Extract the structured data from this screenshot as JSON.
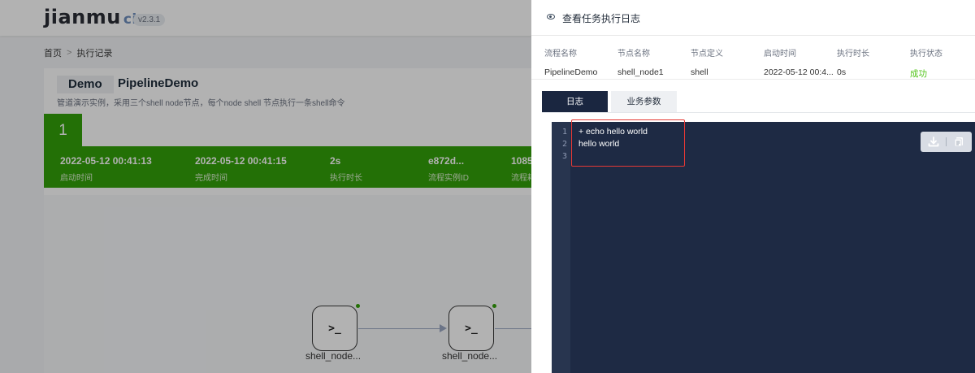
{
  "app": {
    "logo_main": "jianmu",
    "logo_suffix": "ci",
    "version": "v2.3.1"
  },
  "breadcrumb": {
    "home": "首页",
    "separator": ">",
    "current": "执行记录"
  },
  "project": {
    "tag": "Demo",
    "name": "PipelineDemo",
    "description": "管道演示实例，采用三个shell node节点，每个node shell 节点执行一条shell命令"
  },
  "run": {
    "number": "1",
    "status_color": "#33a10a",
    "stats": [
      {
        "value": "2022-05-12 00:41:13",
        "label": "启动时间"
      },
      {
        "value": "2022-05-12 00:41:15",
        "label": "完成时间"
      },
      {
        "value": "2s",
        "label": "执行时长"
      },
      {
        "value": "e872d...",
        "label": "流程实例ID"
      },
      {
        "value": "1085",
        "label": "流程耗"
      }
    ]
  },
  "graph": {
    "nodes": [
      {
        "icon": "terminal-icon",
        "glyph": ">_",
        "label": "shell_node..."
      },
      {
        "icon": "terminal-icon",
        "glyph": ">_",
        "label": "shell_node..."
      }
    ]
  },
  "drawer": {
    "title": "查看任务执行日志",
    "meta": [
      {
        "header": "流程名称",
        "value": "PipelineDemo"
      },
      {
        "header": "节点名称",
        "value": "shell_node1"
      },
      {
        "header": "节点定义",
        "value": "shell"
      },
      {
        "header": "启动时间",
        "value": "2022-05-12 00:4..."
      },
      {
        "header": "执行时长",
        "value": "0s"
      },
      {
        "header": "执行状态",
        "value": "成功"
      }
    ],
    "status_success_color": "#52c41a",
    "tabs": [
      {
        "label": "日志",
        "active": true
      },
      {
        "label": "业务参数",
        "active": false
      }
    ],
    "log": {
      "line_numbers": [
        "1",
        "2",
        "3"
      ],
      "lines": [
        "+ echo hello world",
        "hello world",
        ""
      ],
      "editor_bg": "#1e2a44",
      "highlight_color": "#e53935"
    },
    "tools": {
      "download_icon": "download-icon",
      "copy_icon": "copy-icon"
    }
  }
}
